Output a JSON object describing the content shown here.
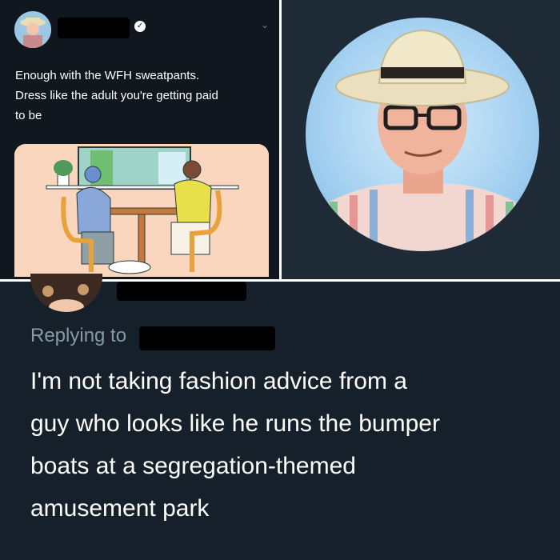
{
  "tweet": {
    "text_line1": "Enough with the WFH sweatpants.",
    "text_line2": "Dress like the adult you're getting paid",
    "text_line3": "to be"
  },
  "reply": {
    "replying_label": "Replying to",
    "text_line1": "I'm not taking fashion advice from a",
    "text_line2": "guy who looks like he runs the bumper",
    "text_line3": "boats at a segregation-themed",
    "text_line4": "amusement park"
  },
  "colors": {
    "background_dark": "#15202b",
    "text_primary": "#ffffff",
    "text_secondary": "#8899a6",
    "card_bg": "#fbd6bf"
  },
  "icons": {
    "verified": "verified-badge-icon",
    "more": "chevron-down-icon"
  }
}
